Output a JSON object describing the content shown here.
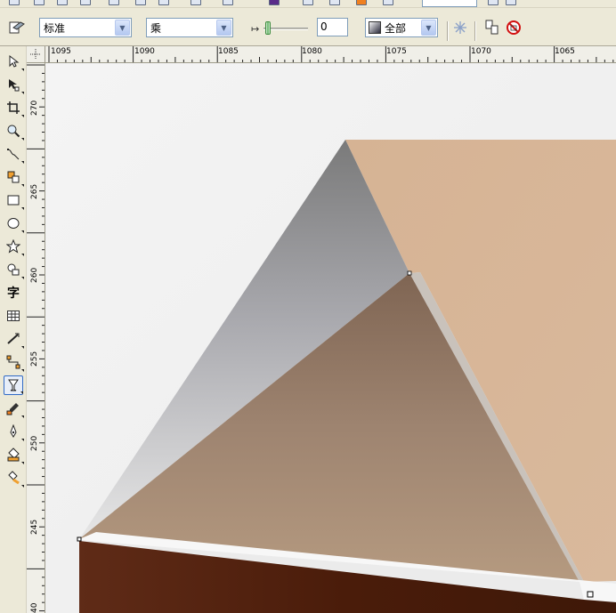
{
  "property_bar": {
    "mode_value": "标准",
    "merge_value": "乘",
    "amount_value": "0",
    "target_value": "全部"
  },
  "rulers": {
    "horizontal_labels": [
      "1095",
      "1090",
      "1085",
      "1080",
      "1075",
      "1070",
      "1065"
    ],
    "vertical_labels": [
      "270",
      "265",
      "260",
      "255",
      "250",
      "245",
      "40"
    ]
  },
  "toolbox": {
    "tools": [
      {
        "icon": "pick-tool-icon"
      },
      {
        "icon": "shape-tool-icon"
      },
      {
        "icon": "crop-tool-icon"
      },
      {
        "icon": "zoom-tool-icon"
      },
      {
        "icon": "freehand-tool-icon"
      },
      {
        "icon": "smart-fill-tool-icon"
      },
      {
        "icon": "rectangle-tool-icon"
      },
      {
        "icon": "ellipse-tool-icon"
      },
      {
        "icon": "polygon-tool-icon"
      },
      {
        "icon": "basic-shapes-tool-icon"
      },
      {
        "icon": "text-tool-icon",
        "glyph": "字"
      },
      {
        "icon": "table-tool-icon"
      },
      {
        "icon": "dimension-tool-icon"
      },
      {
        "icon": "connector-tool-icon"
      },
      {
        "icon": "transparency-tool-icon",
        "active": true
      },
      {
        "icon": "eyedropper-tool-icon"
      },
      {
        "icon": "outline-tool-icon"
      },
      {
        "icon": "fill-tool-icon"
      },
      {
        "icon": "interactive-fill-tool-icon"
      }
    ]
  },
  "colors": {
    "ui_background": "#ece9d8",
    "canvas_background": "#f1f1f1",
    "roof_light": "#d8b597",
    "roof_gable_top": "#7f6553",
    "roof_gable_bottom": "#b4977c",
    "gable_shadow_top": "#7a7a7a",
    "gable_shadow_bottom": "#e5e5e5",
    "wall_dark": "#4a1c0a"
  }
}
